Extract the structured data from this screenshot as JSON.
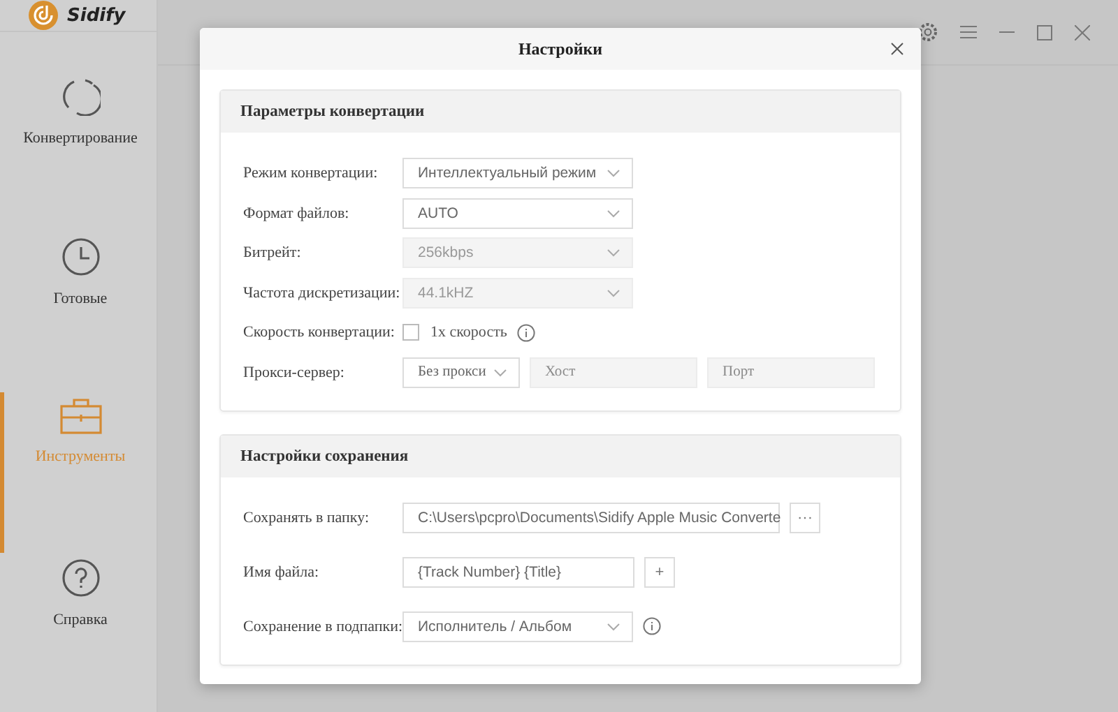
{
  "app": {
    "name": "Sidify"
  },
  "sidebar": {
    "items": [
      {
        "label": "Конвертирование",
        "selected": false
      },
      {
        "label": "Готовые",
        "selected": false
      },
      {
        "label": "Инструменты",
        "selected": true
      },
      {
        "label": "Справка",
        "selected": false
      }
    ]
  },
  "dialog": {
    "title": "Настройки",
    "sections": [
      {
        "title": "Параметры конвертации",
        "rows": [
          {
            "label": "Режим конвертации:",
            "controls": [
              {
                "kind": "select",
                "value": "Интеллектуальный режим",
                "disabled": false
              }
            ]
          },
          {
            "label": "Формат файлов:",
            "controls": [
              {
                "kind": "select",
                "value": "AUTO",
                "disabled": false
              }
            ]
          },
          {
            "label": "Битрейт:",
            "controls": [
              {
                "kind": "select",
                "value": "256kbps",
                "disabled": true
              }
            ]
          },
          {
            "label": "Частота дискретизации:",
            "controls": [
              {
                "kind": "select",
                "value": "44.1kHZ",
                "disabled": true
              }
            ]
          },
          {
            "label": "Скорость конвертации:",
            "controls": [
              {
                "kind": "checkbox",
                "label": "1x скорость",
                "checked": false
              },
              {
                "kind": "info"
              }
            ]
          },
          {
            "label": "Прокси-сервер:",
            "controls": [
              {
                "kind": "compact-select",
                "value": "Без прокси",
                "disabled": false
              },
              {
                "kind": "field",
                "placeholder": "Хост",
                "disabled": true
              },
              {
                "kind": "field",
                "placeholder": "Порт",
                "disabled": true
              }
            ]
          }
        ]
      },
      {
        "title": "Настройки сохранения",
        "rows": [
          {
            "label": "Сохранять в папку:",
            "controls": [
              {
                "kind": "long-field",
                "value": "C:\\Users\\pcpro\\Documents\\Sidify Apple Music Converte",
                "disabled": false
              },
              {
                "kind": "button",
                "label": "···"
              }
            ]
          },
          {
            "label": "Имя файла:",
            "controls": [
              {
                "kind": "name-field",
                "value": "{Track Number} {Title}",
                "disabled": false
              },
              {
                "kind": "button",
                "label": "+"
              }
            ]
          },
          {
            "label": "Сохранение в подпапки:",
            "controls": [
              {
                "kind": "select",
                "value": "Исполнитель / Альбом",
                "disabled": false
              },
              {
                "kind": "info"
              }
            ]
          }
        ]
      }
    ]
  }
}
